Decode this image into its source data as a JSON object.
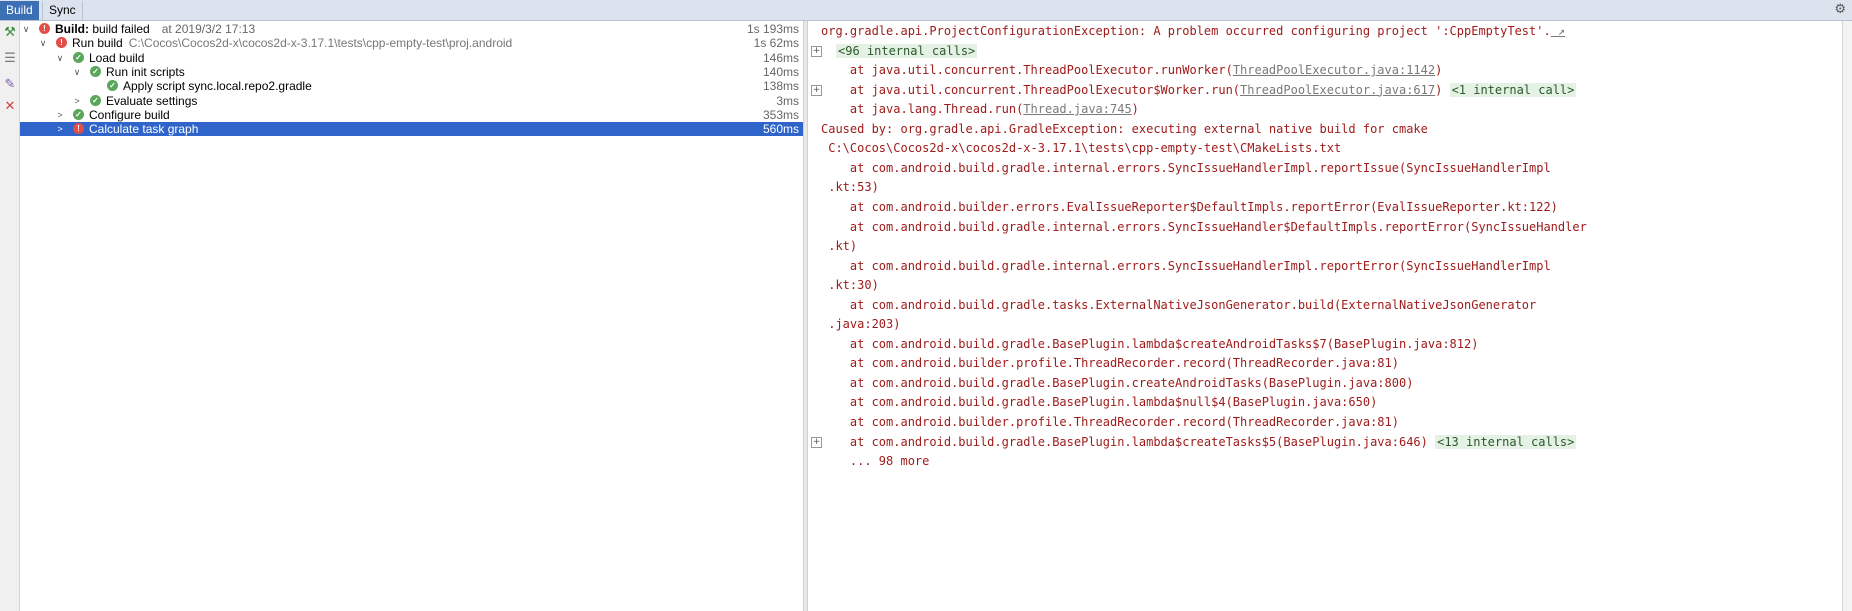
{
  "tabs": [
    {
      "label": "Build",
      "active": true
    },
    {
      "label": "Sync",
      "active": false
    }
  ],
  "header_icons": [
    "gear-icon"
  ],
  "toolbar_icons": [
    "hammer-icon",
    "filter-icon",
    "pin-icon",
    "close-icon"
  ],
  "tree": [
    {
      "chevron": "expanded",
      "status": "error",
      "label_bold": "Build:",
      "label": " build failed",
      "timestamp": "at 2019/3/2 17:13",
      "duration": "1s 193ms"
    },
    {
      "chevron": "expanded",
      "status": "error",
      "label": "Run build",
      "path": "C:\\Cocos\\Cocos2d-x\\cocos2d-x-3.17.1\\tests\\cpp-empty-test\\proj.android",
      "duration": "1s 62ms"
    },
    {
      "chevron": "expanded",
      "status": "ok",
      "label": "Load build",
      "duration": "146ms"
    },
    {
      "chevron": "expanded",
      "status": "ok",
      "label": "Run init scripts",
      "duration": "140ms"
    },
    {
      "chevron": "none",
      "status": "ok",
      "label": "Apply script sync.local.repo2.gradle",
      "duration": "138ms"
    },
    {
      "chevron": "collapsed",
      "status": "ok",
      "label": "Evaluate settings",
      "duration": "3ms"
    },
    {
      "chevron": "collapsed",
      "status": "ok",
      "label": "Configure build",
      "duration": "353ms"
    },
    {
      "chevron": "collapsed",
      "status": "error",
      "label": "Calculate task graph",
      "duration": "560ms",
      "selected": true
    }
  ],
  "console": [
    {
      "text": "org.gradle.api.ProjectConfigurationException: A problem occurred configuring project ':CppEmptyTest'.",
      "suffix": "↗"
    },
    {
      "fold": "<96 internal calls>",
      "plus": true
    },
    {
      "pre": "    at java.util.concurrent.ThreadPoolExecutor.runWorker(",
      "link": "ThreadPoolExecutor.java:1142",
      "post": ")"
    },
    {
      "pre": "    at java.util.concurrent.ThreadPoolExecutor$Worker.run(",
      "link": "ThreadPoolExecutor.java:617",
      "post": ") ",
      "fold": "<1 internal call>",
      "plus": true
    },
    {
      "pre": "    at java.lang.Thread.run(",
      "link": "Thread.java:745",
      "post": ")"
    },
    {
      "text": "Caused by: org.gradle.api.GradleException: executing external native build for cmake"
    },
    {
      "text": " C:\\Cocos\\Cocos2d-x\\cocos2d-x-3.17.1\\tests\\cpp-empty-test\\CMakeLists.txt"
    },
    {
      "text": "    at com.android.build.gradle.internal.errors.SyncIssueHandlerImpl.reportIssue(SyncIssueHandlerImpl"
    },
    {
      "text": " .kt:53)"
    },
    {
      "text": "    at com.android.builder.errors.EvalIssueReporter$DefaultImpls.reportError(EvalIssueReporter.kt:122)"
    },
    {
      "text": "    at com.android.build.gradle.internal.errors.SyncIssueHandler$DefaultImpls.reportError(SyncIssueHandler"
    },
    {
      "text": " .kt)"
    },
    {
      "text": "    at com.android.build.gradle.internal.errors.SyncIssueHandlerImpl.reportError(SyncIssueHandlerImpl"
    },
    {
      "text": " .kt:30)"
    },
    {
      "text": "    at com.android.build.gradle.tasks.ExternalNativeJsonGenerator.build(ExternalNativeJsonGenerator"
    },
    {
      "text": " .java:203)"
    },
    {
      "text": "    at com.android.build.gradle.BasePlugin.lambda$createAndroidTasks$7(BasePlugin.java:812)"
    },
    {
      "text": "    at com.android.builder.profile.ThreadRecorder.record(ThreadRecorder.java:81)"
    },
    {
      "text": "    at com.android.build.gradle.BasePlugin.createAndroidTasks(BasePlugin.java:800)"
    },
    {
      "text": "    at com.android.build.gradle.BasePlugin.lambda$null$4(BasePlugin.java:650)"
    },
    {
      "text": "    at com.android.builder.profile.ThreadRecorder.record(ThreadRecorder.java:81)"
    },
    {
      "text": "    at com.android.build.gradle.BasePlugin.lambda$createTasks$5(BasePlugin.java:646) ",
      "fold": "<13 internal calls>",
      "plus": true
    },
    {
      "text": "    ... 98 more"
    }
  ]
}
